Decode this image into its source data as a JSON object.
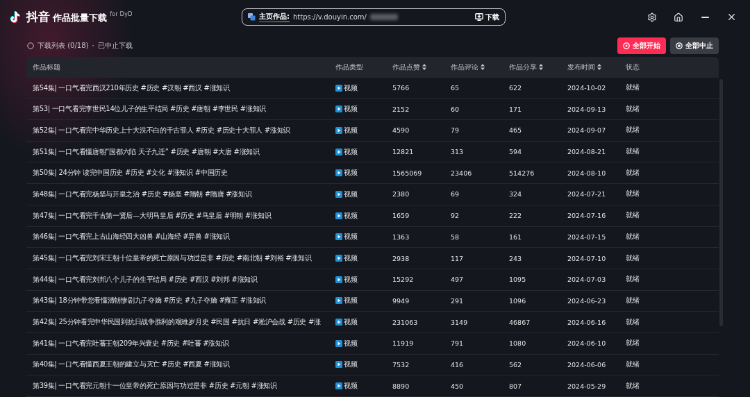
{
  "app": {
    "brand": "抖音",
    "title": "作品批量下载",
    "subtitle": "for DyD"
  },
  "url_bar": {
    "label": "主页作品:",
    "value": "https://v.douyin.com/",
    "button": "下载"
  },
  "status": {
    "list": "下载列表 (0/18)",
    "separator": "·",
    "state": "已中止下载"
  },
  "actions": [
    {
      "kind": "start",
      "label": "全部开始"
    },
    {
      "kind": "stop",
      "label": "全部中止"
    }
  ],
  "table": {
    "columns": [
      {
        "label": "作品标题",
        "sortable": false
      },
      {
        "label": "作品类型",
        "sortable": false
      },
      {
        "label": "作品点赞",
        "sortable": true
      },
      {
        "label": "作品评论",
        "sortable": true
      },
      {
        "label": "作品分享",
        "sortable": true
      },
      {
        "label": "发布时间",
        "sortable": true
      },
      {
        "label": "状态",
        "sortable": false
      }
    ],
    "rows": [
      {
        "title": "第54集| 一口气看完西汉210年历史 #历史 #汉朝 #西汉 #涨知识",
        "type": "视频",
        "likes": "5766",
        "comments": "65",
        "shares": "622",
        "date": "2024-10-02",
        "status": "就绪"
      },
      {
        "title": "第53| 一口气看完李世民14位儿子的生平结局 #历史 #唐朝 #李世民 #涨知识",
        "type": "视频",
        "likes": "2152",
        "comments": "60",
        "shares": "171",
        "date": "2024-09-13",
        "status": "就绪"
      },
      {
        "title": "第52集| 一口气看完中华历史上十大洗不白的千古罪人 #历史 #历史十大罪人 #涨知识",
        "type": "视频",
        "likes": "4590",
        "comments": "79",
        "shares": "465",
        "date": "2024-09-07",
        "status": "就绪"
      },
      {
        "title": "第51集| 一口气看懂唐朝“国都六陷 天子九迁” #历史 #唐朝 #大唐 #涨知识",
        "type": "视频",
        "likes": "12821",
        "comments": "313",
        "shares": "594",
        "date": "2024-08-21",
        "status": "就绪"
      },
      {
        "title": "第50集| 24分钟 读完中国历史 #历史 #文化 #涨知识 #中国历史",
        "type": "视频",
        "likes": "1565069",
        "comments": "23406",
        "shares": "514276",
        "date": "2024-08-10",
        "status": "就绪"
      },
      {
        "title": "第48集| 一口气看完杨坚与开皇之治 #历史 #杨坚 #隋朝 #隋唐 #涨知识",
        "type": "视频",
        "likes": "2380",
        "comments": "69",
        "shares": "324",
        "date": "2024-07-21",
        "status": "就绪"
      },
      {
        "title": "第47集| 一口气看完千古第一贤后—大明马皇后 #历史 #马皇后 #明朝 #涨知识",
        "type": "视频",
        "likes": "1659",
        "comments": "92",
        "shares": "222",
        "date": "2024-07-16",
        "status": "就绪"
      },
      {
        "title": "第46集| 一口气看完上古山海经四大凶兽 #山海经 #异兽 #涨知识",
        "type": "视频",
        "likes": "1363",
        "comments": "58",
        "shares": "161",
        "date": "2024-07-15",
        "status": "就绪"
      },
      {
        "title": "第45集| 一口气看完刘宋王朝十位皇帝的死亡原因与功过是非 #历史 #南北朝 #刘裕 #涨知识",
        "type": "视频",
        "likes": "2938",
        "comments": "117",
        "shares": "243",
        "date": "2024-07-10",
        "status": "就绪"
      },
      {
        "title": "第44集| 一口气看完刘邦八个儿子的生平结局 #历史 #西汉 #刘邦 #涨知识",
        "type": "视频",
        "likes": "15292",
        "comments": "497",
        "shares": "1095",
        "date": "2024-07-03",
        "status": "就绪"
      },
      {
        "title": "第43集| 18分钟带您看懂清朝惨剧九子夺嫡 #历史 #九子夺嫡 #雍正 #涨知识",
        "type": "视频",
        "likes": "9949",
        "comments": "291",
        "shares": "1096",
        "date": "2024-06-23",
        "status": "就绪"
      },
      {
        "title": "第42集| 25分钟看完中华民国到抗日战争胜利的艰难岁月史 #民国 #抗日 #淞沪会战 #历史 #涨",
        "type": "视频",
        "likes": "231063",
        "comments": "3149",
        "shares": "46867",
        "date": "2024-06-16",
        "status": "就绪"
      },
      {
        "title": "第41集| 一口气看完吐蕃王朝209年兴衰史 #历史 #吐蕃 #涨知识",
        "type": "视频",
        "likes": "11919",
        "comments": "791",
        "shares": "1080",
        "date": "2024-06-10",
        "status": "就绪"
      },
      {
        "title": "第40集| 一口气看懂西夏王朝的建立与灭亡 #历史 #西夏 #涨知识",
        "type": "视频",
        "likes": "7532",
        "comments": "416",
        "shares": "562",
        "date": "2024-06-06",
        "status": "就绪"
      },
      {
        "title": "第39集| 一口气看完元朝十一位皇帝的死亡原因与功过是非 #历史 #元朝 #涨知识",
        "type": "视频",
        "likes": "8890",
        "comments": "450",
        "shares": "807",
        "date": "2024-05-29",
        "status": "就绪"
      }
    ]
  }
}
